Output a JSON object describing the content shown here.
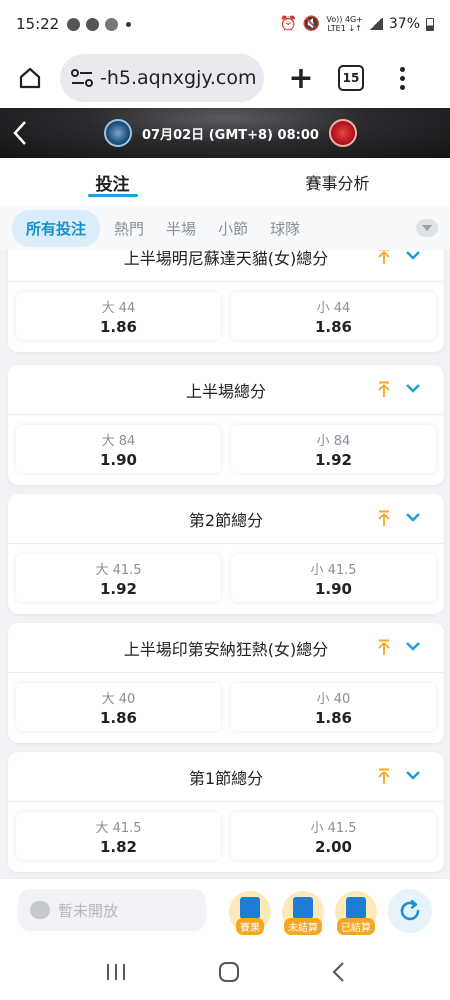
{
  "status_bar": {
    "time": "15:22",
    "network_top": "Vo)) 4G+",
    "network_bottom": "LTE1 ↓↑",
    "battery": "37%"
  },
  "browser": {
    "url": "-h5.aqnxgjy.com",
    "tab_count": "15"
  },
  "match": {
    "info": "07月02日 (GMT+8)  08:00"
  },
  "tabs": [
    {
      "label": "投注"
    },
    {
      "label": "賽事分析"
    }
  ],
  "filters": [
    {
      "label": "所有投注"
    },
    {
      "label": "熱門"
    },
    {
      "label": "半場"
    },
    {
      "label": "小節"
    },
    {
      "label": "球隊"
    }
  ],
  "markets": [
    {
      "title": "上半場明尼蘇達天貓(女)總分",
      "over": {
        "label": "大 44",
        "odds": "1.86"
      },
      "under": {
        "label": "小 44",
        "odds": "1.86"
      }
    },
    {
      "title": "上半場總分",
      "over": {
        "label": "大 84",
        "odds": "1.90"
      },
      "under": {
        "label": "小 84",
        "odds": "1.92"
      }
    },
    {
      "title": "第2節總分",
      "over": {
        "label": "大 41.5",
        "odds": "1.92"
      },
      "under": {
        "label": "小 41.5",
        "odds": "1.90"
      }
    },
    {
      "title": "上半場印第安納狂熱(女)總分",
      "over": {
        "label": "大 40",
        "odds": "1.86"
      },
      "under": {
        "label": "小 40",
        "odds": "1.86"
      }
    },
    {
      "title": "第1節總分",
      "over": {
        "label": "大 41.5",
        "odds": "1.82"
      },
      "under": {
        "label": "小 41.5",
        "odds": "2.00"
      }
    }
  ],
  "bottom_bar": {
    "chat_placeholder": "暫未開放",
    "buttons": [
      {
        "label": "賽果",
        "icon": "results-icon"
      },
      {
        "label": "未結算",
        "icon": "unsettled-icon"
      },
      {
        "label": "已結算",
        "icon": "settled-icon"
      }
    ]
  },
  "colors": {
    "accent": "#1e9fd8",
    "pin": "#f5a623",
    "tag": "#f5a623"
  }
}
